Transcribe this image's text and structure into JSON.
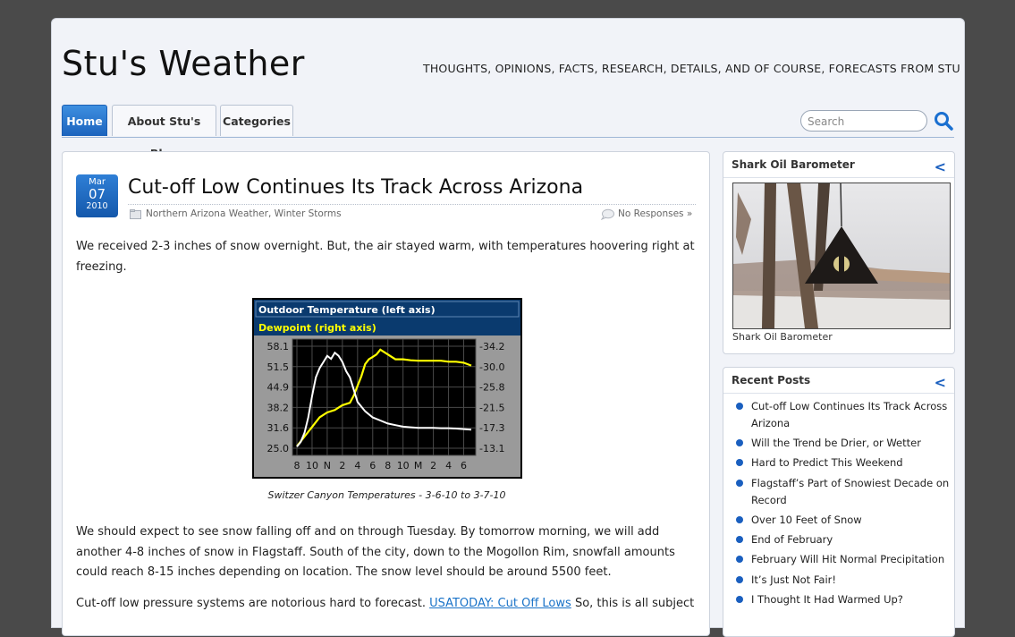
{
  "site": {
    "title": "Stu's Weather",
    "tagline": "THOUGHTS, OPINIONS, FACTS, RESEARCH, DETAILS, AND OF COURSE, FORECASTS FROM STU"
  },
  "nav": {
    "items": [
      {
        "label": "Home"
      },
      {
        "label": "About Stu's Blog"
      },
      {
        "label": "Categories"
      }
    ]
  },
  "search": {
    "placeholder": "Search"
  },
  "post": {
    "date": {
      "month": "Mar",
      "day": "07",
      "year": "2010"
    },
    "title": "Cut-off Low Continues Its Track Across Arizona",
    "categories": [
      "Northern Arizona Weather",
      "Winter Storms"
    ],
    "responses": "No Responses »",
    "para1": "We received 2-3 inches of snow overnight. But, the air stayed warm, with temperatures hoovering right at freezing.",
    "caption": "Switzer Canyon Temperatures - 3-6-10 to 3-7-10",
    "para2": "We should expect to see snow falling off and on through Tuesday. By tomorrow morning, we will add another 4-8 inches of snow in Flagstaff. South of the city, down to the Mogollon Rim, snowfall amounts could reach 8-15 inches depending on location. The snow level should be around 5500 feet.",
    "para3_start": "Cut-off low pressure systems are notorious hard to forecast.",
    "para3_link": "USATODAY: Cut Off Lows",
    "para3_end": "So, this is all subject"
  },
  "chart_data": {
    "type": "line",
    "legend": [
      "Outdoor Temperature (left axis)",
      "Dewpoint (right axis)"
    ],
    "x_ticks": [
      "8",
      "10",
      "N",
      "2",
      "4",
      "6",
      "8",
      "10",
      "M",
      "2",
      "4",
      "6"
    ],
    "y_left_ticks": [
      "58.1",
      "51.5",
      "44.9",
      "38.2",
      "31.6",
      "25.0"
    ],
    "y_right_ticks": [
      "34.2",
      "30.0",
      "25.8",
      "21.5",
      "17.3",
      "13.1"
    ],
    "ylim_left": [
      25.0,
      58.1
    ],
    "ylim_right": [
      13.1,
      34.2
    ],
    "colors": {
      "temperature": "#ffffff",
      "dewpoint": "#ffff00",
      "plot_bg": "#000000",
      "header_bg": "#0a3a6e"
    },
    "series": [
      {
        "name": "Outdoor Temperature (left axis)",
        "axis": "left",
        "x": [
          0,
          0.5,
          1,
          1.5,
          2,
          2.5,
          3,
          3.5,
          4,
          4.5,
          5,
          5.5,
          6,
          6.5,
          7,
          7.5,
          8,
          9,
          10,
          11,
          12,
          13,
          14,
          15,
          16,
          17,
          18,
          19,
          20,
          21,
          22,
          23
        ],
        "values": [
          25.5,
          27,
          30,
          35,
          42,
          48,
          51,
          53,
          55,
          54,
          56,
          55,
          53,
          50,
          48,
          44,
          40,
          37,
          35,
          34,
          33,
          32.5,
          32,
          31.8,
          31.6,
          31.6,
          31.6,
          31.5,
          31.5,
          31.4,
          31.2,
          31.0
        ]
      },
      {
        "name": "Dewpoint (right axis)",
        "axis": "right",
        "x": [
          0,
          1,
          2,
          3,
          4,
          5,
          6,
          7,
          7.5,
          8,
          8.5,
          9,
          9.5,
          10,
          10.5,
          11,
          12,
          13,
          14,
          15,
          16,
          17,
          18,
          19,
          20,
          21,
          22,
          23
        ],
        "values": [
          13.5,
          15.5,
          17.5,
          19.5,
          20.5,
          21,
          22,
          22.5,
          24,
          26,
          28,
          30.5,
          31.5,
          32,
          32.5,
          33.5,
          32.5,
          31.5,
          31.5,
          31.3,
          31.2,
          31.2,
          31.2,
          31.2,
          31.0,
          31.0,
          30.8,
          30.2
        ]
      }
    ]
  },
  "sidebar": {
    "barometer": {
      "title": "Shark Oil Barometer",
      "caption": "Shark Oil Barometer"
    },
    "recent": {
      "title": "Recent Posts",
      "items": [
        {
          "label": "Cut-off Low Continues Its Track Across Arizona"
        },
        {
          "label": "Will the Trend be Drier, or Wetter"
        },
        {
          "label": "Hard to Predict This Weekend"
        },
        {
          "label": "Flagstaff’s Part of Snowiest Decade on Record"
        },
        {
          "label": "Over 10 Feet of Snow"
        },
        {
          "label": "End of February"
        },
        {
          "label": "February Will Hit Normal Precipitation"
        },
        {
          "label": "It’s Just Not Fair!"
        },
        {
          "label": "I Thought It Had Warmed Up?"
        }
      ]
    }
  }
}
